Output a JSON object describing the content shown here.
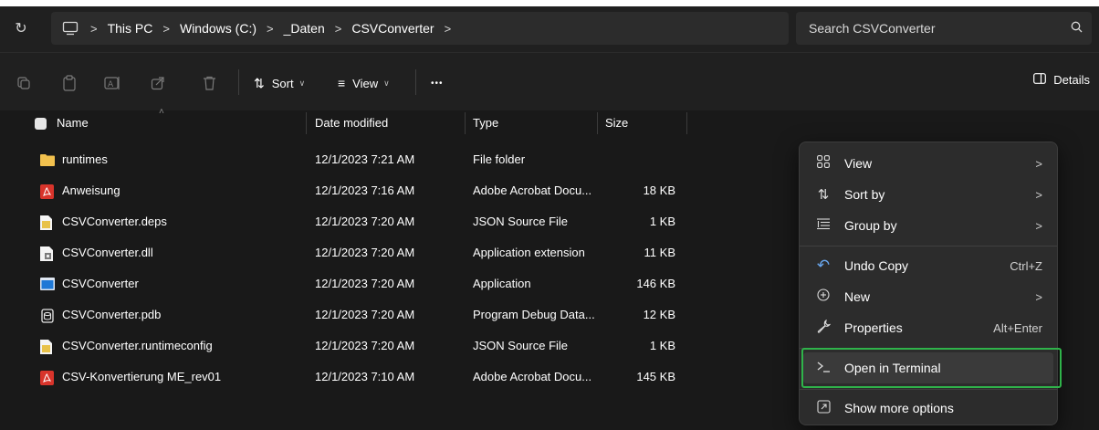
{
  "address": {
    "refresh_icon": "refresh-icon",
    "crumbs": [
      "This PC",
      "Windows (C:)",
      "_Daten",
      "CSVConverter"
    ],
    "search_placeholder": "Search CSVConverter"
  },
  "toolbar": {
    "sort_label": "Sort",
    "view_label": "View",
    "more_label": "•••",
    "details_label": "Details"
  },
  "columns": {
    "name": "Name",
    "date": "Date modified",
    "type": "Type",
    "size": "Size"
  },
  "files": [
    {
      "name": "runtimes",
      "date": "12/1/2023 7:21 AM",
      "type": "File folder",
      "size": "",
      "icon": "folder-icon"
    },
    {
      "name": "Anweisung",
      "date": "12/1/2023 7:16 AM",
      "type": "Adobe Acrobat Docu...",
      "size": "18 KB",
      "icon": "pdf-icon"
    },
    {
      "name": "CSVConverter.deps",
      "date": "12/1/2023 7:20 AM",
      "type": "JSON Source File",
      "size": "1 KB",
      "icon": "json-file-icon"
    },
    {
      "name": "CSVConverter.dll",
      "date": "12/1/2023 7:20 AM",
      "type": "Application extension",
      "size": "11 KB",
      "icon": "dll-file-icon"
    },
    {
      "name": "CSVConverter",
      "date": "12/1/2023 7:20 AM",
      "type": "Application",
      "size": "146 KB",
      "icon": "application-icon"
    },
    {
      "name": "CSVConverter.pdb",
      "date": "12/1/2023 7:20 AM",
      "type": "Program Debug Data...",
      "size": "12 KB",
      "icon": "pdb-file-icon"
    },
    {
      "name": "CSVConverter.runtimeconfig",
      "date": "12/1/2023 7:20 AM",
      "type": "JSON Source File",
      "size": "1 KB",
      "icon": "json-file-icon"
    },
    {
      "name": "CSV-Konvertierung ME_rev01",
      "date": "12/1/2023 7:10 AM",
      "type": "Adobe Acrobat Docu...",
      "size": "145 KB",
      "icon": "pdf-icon"
    }
  ],
  "context_menu": {
    "view": "View",
    "sort_by": "Sort by",
    "group_by": "Group by",
    "undo_copy": "Undo Copy",
    "undo_shortcut": "Ctrl+Z",
    "new": "New",
    "properties": "Properties",
    "properties_shortcut": "Alt+Enter",
    "open_terminal": "Open in Terminal",
    "show_more": "Show more options"
  },
  "colors": {
    "highlight_border": "#2fb34a",
    "folder": "#f2c14e",
    "pdf": "#d8342b",
    "application": "#1e78d6"
  }
}
